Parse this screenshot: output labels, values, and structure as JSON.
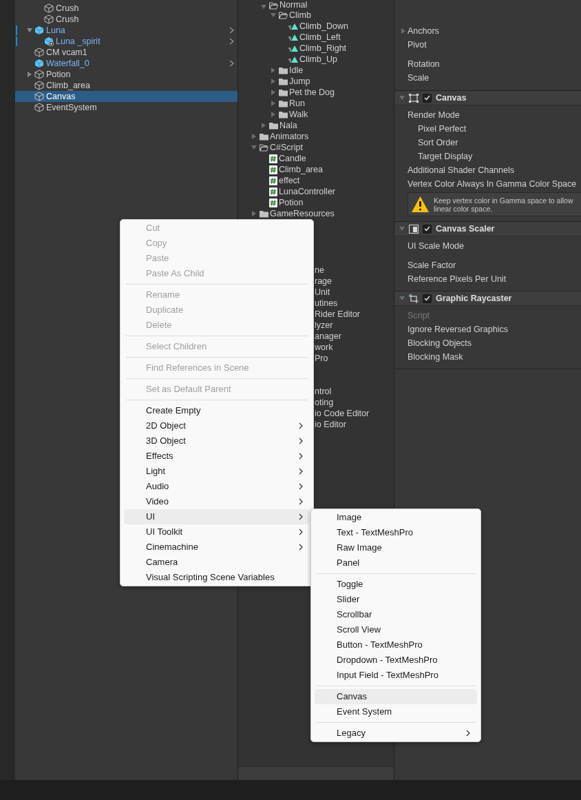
{
  "hierarchy": {
    "cut_off_children": [
      {
        "name": "Crush",
        "kind": "object",
        "selected": false,
        "modified": false
      },
      {
        "name": "Crush",
        "kind": "object",
        "selected": false,
        "modified": false
      }
    ],
    "items": [
      {
        "name": "Luna",
        "kind": "prefab",
        "selected": false,
        "modified": true,
        "expanded": true,
        "children": [
          {
            "name": "Luna _spirit",
            "kind": "prefab_variant",
            "selected": false,
            "modified": true
          }
        ]
      },
      {
        "name": "CM vcam1",
        "kind": "object",
        "selected": false,
        "modified": false
      },
      {
        "name": "Waterfall_0",
        "kind": "prefab",
        "selected": false,
        "modified": false
      },
      {
        "name": "Potion",
        "kind": "object",
        "selected": false,
        "modified": false,
        "expanded": false
      },
      {
        "name": "Climb_area",
        "kind": "object",
        "selected": false,
        "modified": false
      },
      {
        "name": "Canvas",
        "kind": "object",
        "selected": true,
        "modified": false
      },
      {
        "name": "EventSystem",
        "kind": "object",
        "selected": false,
        "modified": false
      }
    ]
  },
  "project": {
    "cut_off_children": [
      {
        "name": "Normal",
        "kind": "folder",
        "expanded": true,
        "children": [
          {
            "name": "Climb",
            "kind": "folder",
            "expanded": true,
            "children": [
              {
                "name": "Climb_Down",
                "kind": "animation"
              },
              {
                "name": "Climb_Left",
                "kind": "animation"
              },
              {
                "name": "Climb_Right",
                "kind": "animation"
              },
              {
                "name": "Climb_Up",
                "kind": "animation"
              }
            ]
          },
          {
            "name": "Idle",
            "kind": "folder",
            "expanded": false
          },
          {
            "name": "Jump",
            "kind": "folder",
            "expanded": false
          },
          {
            "name": "Pet the Dog",
            "kind": "folder",
            "expanded": false
          },
          {
            "name": "Run",
            "kind": "folder",
            "expanded": false
          },
          {
            "name": "Walk",
            "kind": "folder",
            "expanded": false
          }
        ]
      },
      {
        "name": "Nala",
        "kind": "folder",
        "expanded": false
      }
    ],
    "items": [
      {
        "name": "Animators",
        "kind": "folder",
        "expanded": false
      },
      {
        "name": "C#Script",
        "kind": "folder",
        "expanded": true,
        "children": [
          {
            "name": "Candle",
            "kind": "script"
          },
          {
            "name": "Climb_area",
            "kind": "script"
          },
          {
            "name": "effect",
            "kind": "script"
          },
          {
            "name": "LunaController",
            "kind": "script"
          },
          {
            "name": "Potion",
            "kind": "script"
          }
        ]
      },
      {
        "name": "GameResources",
        "kind": "folder",
        "expanded": false
      }
    ],
    "covered_row_groups": [
      [
        "ne",
        "rage",
        "Unit",
        "utines",
        "Rider Editor",
        "lyzer",
        "anager",
        "work",
        "Pro"
      ],
      [
        "ntrol",
        "oting",
        "io Code Editor",
        "io Editor"
      ]
    ]
  },
  "inspector": {
    "transform_groups": [
      [
        {
          "label": "Anchors",
          "expanded": false,
          "disabled": false
        },
        {
          "label": "Pivot",
          "disabled": false
        }
      ],
      [
        {
          "label": "Rotation",
          "disabled": false
        },
        {
          "label": "Scale",
          "disabled": false
        }
      ]
    ],
    "components": [
      {
        "title": "Canvas",
        "kind": "canvas",
        "enabled": true,
        "expanded": true,
        "groups": [
          [
            {
              "label": "Render Mode",
              "disabled": false,
              "children": [
                {
                  "label": "Pixel Perfect",
                  "disabled": false
                },
                {
                  "label": "Sort Order",
                  "disabled": false
                },
                {
                  "label": "Target Display",
                  "disabled": false
                }
              ]
            },
            {
              "label": "Additional Shader Channels",
              "disabled": false
            },
            {
              "label": "Vertex Color Always In Gamma Color Space",
              "disabled": false
            }
          ]
        ],
        "warning": {
          "lines": [
            "Keep vertex color in Gamma space to allow",
            "linear color space."
          ]
        }
      },
      {
        "title": "Canvas Scaler",
        "kind": "scaler",
        "enabled": true,
        "expanded": true,
        "groups": [
          [
            {
              "label": "UI Scale Mode",
              "disabled": false
            }
          ],
          [
            {
              "label": "Scale Factor",
              "disabled": false
            },
            {
              "label": "Reference Pixels Per Unit",
              "disabled": false
            }
          ]
        ]
      },
      {
        "title": "Graphic Raycaster",
        "kind": "raycaster",
        "enabled": true,
        "expanded": true,
        "groups": [
          [
            {
              "label": "Script",
              "disabled": true
            },
            {
              "label": "Ignore Reversed Graphics",
              "disabled": false
            },
            {
              "label": "Blocking Objects",
              "disabled": false
            },
            {
              "label": "Blocking Mask",
              "disabled": false
            }
          ]
        ]
      }
    ]
  },
  "context_menu": {
    "sections": [
      [
        {
          "label": "Cut",
          "disabled": true,
          "submenu": false,
          "highlighted": false
        },
        {
          "label": "Copy",
          "disabled": true,
          "submenu": false,
          "highlighted": false
        },
        {
          "label": "Paste",
          "disabled": true,
          "submenu": false,
          "highlighted": false
        },
        {
          "label": "Paste As Child",
          "disabled": true,
          "submenu": false,
          "highlighted": false
        }
      ],
      [
        {
          "label": "Rename",
          "disabled": true,
          "submenu": false,
          "highlighted": false
        },
        {
          "label": "Duplicate",
          "disabled": true,
          "submenu": false,
          "highlighted": false
        },
        {
          "label": "Delete",
          "disabled": true,
          "submenu": false,
          "highlighted": false
        }
      ],
      [
        {
          "label": "Select Children",
          "disabled": true,
          "submenu": false,
          "highlighted": false
        }
      ],
      [
        {
          "label": "Find References in Scene",
          "disabled": true,
          "submenu": false,
          "highlighted": false
        }
      ],
      [
        {
          "label": "Set as Default Parent",
          "disabled": true,
          "submenu": false,
          "highlighted": false
        }
      ],
      [
        {
          "label": "Create Empty",
          "disabled": false,
          "submenu": false,
          "highlighted": false
        },
        {
          "label": "2D Object",
          "disabled": false,
          "submenu": true,
          "highlighted": false
        },
        {
          "label": "3D Object",
          "disabled": false,
          "submenu": true,
          "highlighted": false
        },
        {
          "label": "Effects",
          "disabled": false,
          "submenu": true,
          "highlighted": false
        },
        {
          "label": "Light",
          "disabled": false,
          "submenu": true,
          "highlighted": false
        },
        {
          "label": "Audio",
          "disabled": false,
          "submenu": true,
          "highlighted": false
        },
        {
          "label": "Video",
          "disabled": false,
          "submenu": true,
          "highlighted": false
        },
        {
          "label": "UI",
          "disabled": false,
          "submenu": true,
          "highlighted": true
        },
        {
          "label": "UI Toolkit",
          "disabled": false,
          "submenu": true,
          "highlighted": false
        },
        {
          "label": "Cinemachine",
          "disabled": false,
          "submenu": true,
          "highlighted": false
        },
        {
          "label": "Camera",
          "disabled": false,
          "submenu": false,
          "highlighted": false
        },
        {
          "label": "Visual Scripting Scene Variables",
          "disabled": false,
          "submenu": false,
          "highlighted": false
        }
      ]
    ]
  },
  "submenu": {
    "sections": [
      [
        {
          "label": "Image",
          "disabled": false,
          "submenu": false,
          "highlighted": false
        },
        {
          "label": "Text - TextMeshPro",
          "disabled": false,
          "submenu": false,
          "highlighted": false
        },
        {
          "label": "Raw Image",
          "disabled": false,
          "submenu": false,
          "highlighted": false
        },
        {
          "label": "Panel",
          "disabled": false,
          "submenu": false,
          "highlighted": false
        }
      ],
      [
        {
          "label": "Toggle",
          "disabled": false,
          "submenu": false,
          "highlighted": false
        },
        {
          "label": "Slider",
          "disabled": false,
          "submenu": false,
          "highlighted": false
        },
        {
          "label": "Scrollbar",
          "disabled": false,
          "submenu": false,
          "highlighted": false
        },
        {
          "label": "Scroll View",
          "disabled": false,
          "submenu": false,
          "highlighted": false
        },
        {
          "label": "Button - TextMeshPro",
          "disabled": false,
          "submenu": false,
          "highlighted": false
        },
        {
          "label": "Dropdown - TextMeshPro",
          "disabled": false,
          "submenu": false,
          "highlighted": false
        },
        {
          "label": "Input Field - TextMeshPro",
          "disabled": false,
          "submenu": false,
          "highlighted": false
        }
      ],
      [
        {
          "label": "Canvas",
          "disabled": false,
          "submenu": false,
          "highlighted": true
        },
        {
          "label": "Event System",
          "disabled": false,
          "submenu": false,
          "highlighted": false
        }
      ],
      [
        {
          "label": "Legacy",
          "disabled": false,
          "submenu": true,
          "highlighted": false
        }
      ]
    ]
  }
}
